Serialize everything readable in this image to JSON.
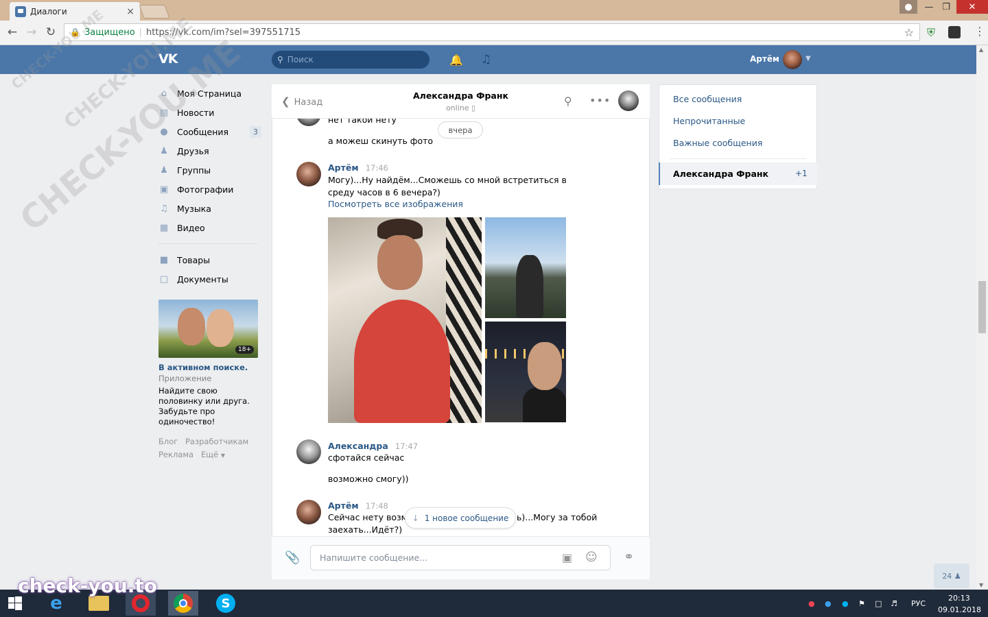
{
  "browser": {
    "tab_title": "Диалоги",
    "tab_close": "×",
    "secure_label": "Защищено",
    "url": "https://vk.com/im?sel=397551715"
  },
  "vk": {
    "search_placeholder": "Поиск",
    "user_name": "Артём"
  },
  "sidebar": {
    "items": [
      {
        "label": "Моя Страница",
        "icon": "home-icon"
      },
      {
        "label": "Новости",
        "icon": "news-icon"
      },
      {
        "label": "Сообщения",
        "icon": "messages-icon",
        "badge": "3"
      },
      {
        "label": "Друзья",
        "icon": "friends-icon"
      },
      {
        "label": "Группы",
        "icon": "groups-icon"
      },
      {
        "label": "Фотографии",
        "icon": "camera-icon"
      },
      {
        "label": "Музыка",
        "icon": "music-icon"
      },
      {
        "label": "Видео",
        "icon": "video-icon"
      },
      {
        "label": "Товары",
        "icon": "bag-icon"
      },
      {
        "label": "Документы",
        "icon": "document-icon"
      }
    ],
    "ad": {
      "badge": "18+",
      "title": "В активном поиске.",
      "subtitle": "Приложение",
      "text": "Найдите свою половинку или друга. Забудьте про одиночество!"
    },
    "footer": {
      "blog": "Блог",
      "dev": "Разработчикам",
      "ads": "Реклама",
      "more": "Ещё"
    }
  },
  "chat": {
    "back_label": "Назад",
    "contact_name": "Александра Франк",
    "contact_status": "online",
    "date_pill": "вчера",
    "messages": [
      {
        "text1": "нет такой нету",
        "text2": "а можеш скинуть фото"
      },
      {
        "author": "Артём",
        "time": "17:46",
        "text": "Могу)...Ну найдём...Сможешь со мной встретиться в среду часов в 6 вечера?)",
        "link": "Посмотреть все изображения"
      },
      {
        "author": "Александра",
        "time": "17:47",
        "text1": "сфотайся сейчас",
        "text2": "возможно смогу))"
      },
      {
        "author": "Артём",
        "time": "17:48",
        "text_start": "Сейчас нету возмо",
        "text_end": "ь)...Могу за тобой",
        "text_line2": "заехать...Идёт?)"
      }
    ],
    "new_message_pill": "1 новое сообщение",
    "input_placeholder": "Напишите сообщение..."
  },
  "right_menu": {
    "all": "Все сообщения",
    "unread": "Непрочитанные",
    "important": "Важные сообщения",
    "active_name": "Александра Франк",
    "active_count": "+1"
  },
  "online_count": "24",
  "watermark": "check-you.to",
  "watermark_diag": "CHECK-YOU.ME",
  "taskbar": {
    "lang": "РУС",
    "time": "20:13",
    "date": "09.01.2018"
  }
}
